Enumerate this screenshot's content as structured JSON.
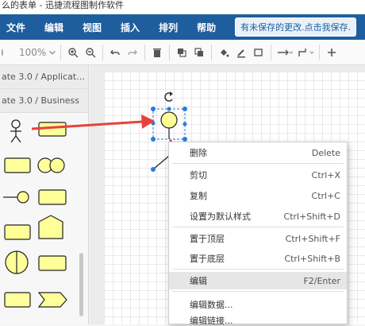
{
  "window": {
    "title": "么的表单 - 迅捷流程图制作软件"
  },
  "menubar": {
    "items": [
      "文件",
      "编辑",
      "视图",
      "插入",
      "排列",
      "帮助"
    ],
    "unsaved_notice": "有未保存的更改.点击我保存."
  },
  "toolbar": {
    "zoom": "100%"
  },
  "sidebar": {
    "sections": [
      "ate 3.0 / Applicat…",
      "ate 3.0 / Business"
    ]
  },
  "context_menu": {
    "items": [
      {
        "label": "删除",
        "shortcut": "Delete"
      },
      {
        "label": "剪切",
        "shortcut": "Ctrl+X"
      },
      {
        "label": "复制",
        "shortcut": "Ctrl+C"
      },
      {
        "label": "设置为默认样式",
        "shortcut": "Ctrl+Shift+D"
      },
      {
        "label": "置于顶层",
        "shortcut": "Ctrl+Shift+F"
      },
      {
        "label": "置于底层",
        "shortcut": "Ctrl+Shift+B"
      },
      {
        "label": "编辑",
        "shortcut": "F2/Enter"
      },
      {
        "label": "编辑数据...",
        "shortcut": ""
      },
      {
        "label": "编辑链接...",
        "shortcut": ""
      }
    ]
  },
  "colors": {
    "menubar": "#1f5e9e",
    "shape_fill": "#ffff99",
    "annotation_arrow": "#e8413c",
    "selection": "#2a7ae2"
  }
}
